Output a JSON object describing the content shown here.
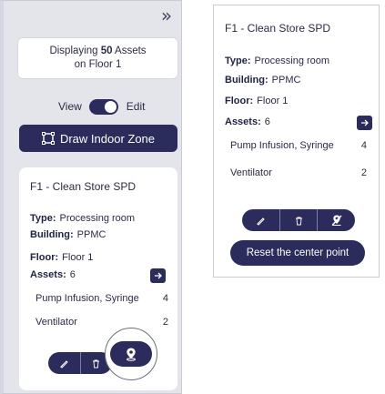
{
  "sidebar": {
    "collapse_glyph": "»",
    "display_prefix": "Displaying ",
    "display_count": "50",
    "display_suffix": " Assets",
    "display_line2": "on Floor 1",
    "view_label": "View",
    "edit_label": "Edit",
    "toggle_state": "edit",
    "draw_zone_label": "Draw Indoor Zone"
  },
  "zone": {
    "title": "F1 - Clean Store SPD",
    "type_label": "Type:",
    "type_value": "Processing room",
    "building_label": "Building:",
    "building_value": "PPMC",
    "floor_label": "Floor:",
    "floor_value": "Floor 1",
    "assets_label": "Assets:",
    "assets_value": "6",
    "assets": [
      {
        "name": "Pump Infusion, Syringe",
        "count": "4"
      },
      {
        "name": "Ventilator",
        "count": "2"
      }
    ]
  },
  "actions": {
    "reset_label": "Reset the center point"
  },
  "icons": {
    "collapse": "double-chevron-right-icon",
    "draw_zone": "dashed-square-icon",
    "arrow": "arrow-right-icon",
    "edit": "pencil-icon",
    "delete": "trash-icon",
    "pin": "map-pin-icon",
    "unpin": "map-pin-off-icon"
  },
  "colors": {
    "primary": "#2b2b5c",
    "panel_bg": "#e3e5eb",
    "card_bg": "#ffffff"
  }
}
